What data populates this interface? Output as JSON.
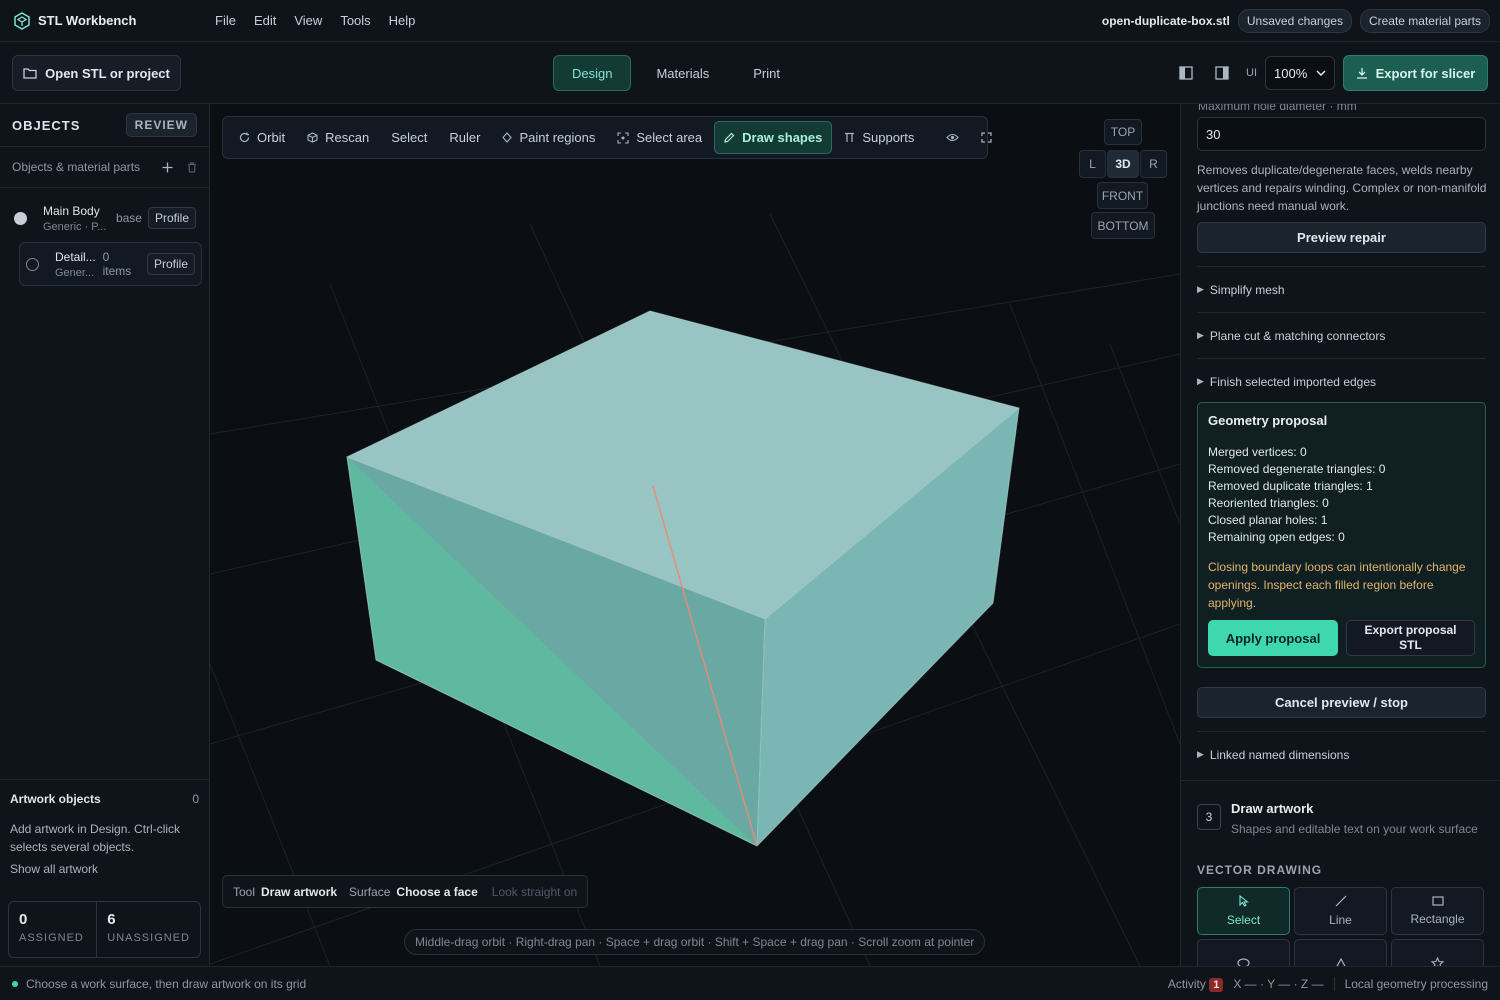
{
  "app": {
    "name": "STL Workbench",
    "menu": [
      "File",
      "Edit",
      "View",
      "Tools",
      "Help"
    ],
    "file_name": "open-duplicate-box.stl",
    "unsaved": "Unsaved changes",
    "create_parts": "Create material parts"
  },
  "toolbar": {
    "open": "Open STL or project",
    "modes": [
      "Design",
      "Materials",
      "Print"
    ],
    "active_mode": "Design",
    "ui_label": "UI",
    "zoom": "100%",
    "export": "Export for slicer"
  },
  "sidebar": {
    "title": "OBJECTS",
    "review": "REVIEW",
    "subtitle": "Objects & material parts",
    "objects": [
      {
        "name": "Main Body",
        "meta": "Generic · P...",
        "tag": "base",
        "profile": "Profile"
      },
      {
        "name": "Detail...",
        "meta": "Gener...",
        "tag": "0 items",
        "profile": "Profile"
      }
    ],
    "artwork": {
      "title": "Artwork objects",
      "count": "0",
      "desc": "Add artwork in Design. Ctrl-click selects several objects.",
      "link": "Show all artwork",
      "assigned": "0",
      "assigned_label": "ASSIGNED",
      "unassigned": "6",
      "unassigned_label": "UNASSIGNED"
    }
  },
  "viewport": {
    "tools": [
      "Orbit",
      "Rescan",
      "Select",
      "Ruler",
      "Paint regions",
      "Select area",
      "Draw shapes",
      "Supports"
    ],
    "active_tool": "Draw shapes",
    "views": {
      "top": "TOP",
      "left": "L",
      "three_d": "3D",
      "right": "R",
      "front": "FRONT",
      "bottom": "BOTTOM"
    },
    "status": {
      "tool_label": "Tool",
      "tool": "Draw artwork",
      "surface_label": "Surface",
      "surface": "Choose a face",
      "hint": "Look straight on"
    },
    "hints": "Middle-drag orbit · Right-drag pan · Space + drag orbit · Shift + Space + drag pan · Scroll zoom at pointer",
    "colors": {
      "box_top": "#98c4c3",
      "box_right": "#7ab7b4",
      "box_front": "#6aa8a3",
      "box_left": "#5fb8a0",
      "edge": "#e78b7a"
    }
  },
  "right_panel": {
    "hole_label": "Maximum hole diameter · mm",
    "hole_value": "30",
    "repair_desc": "Removes duplicate/degenerate faces, welds nearby vertices and repairs winding. Complex or non-manifold junctions need manual work.",
    "preview": "Preview repair",
    "sections": [
      "Simplify mesh",
      "Plane cut & matching connectors",
      "Finish selected imported edges"
    ],
    "proposal": {
      "title": "Geometry proposal",
      "lines": [
        "Merged vertices: 0",
        "Removed degenerate triangles: 0",
        "Removed duplicate triangles: 1",
        "Reoriented triangles: 0",
        "Closed planar holes: 1",
        "Remaining open edges: 0"
      ],
      "warning": "Closing boundary loops can intentionally change openings. Inspect each filled region before applying.",
      "apply": "Apply proposal",
      "export": "Export proposal STL"
    },
    "cancel": "Cancel preview / stop",
    "linked": "Linked named dimensions",
    "draw": {
      "step": "3",
      "title": "Draw artwork",
      "subtitle": "Shapes and editable text on your work surface",
      "vector_label": "VECTOR DRAWING",
      "tools": [
        "Select",
        "Line",
        "Rectangle"
      ]
    }
  },
  "statusbar": {
    "message": "Choose a work surface, then draw artwork on its grid",
    "activity": "Activity",
    "activity_count": "1",
    "coords": "X — · Y — · Z —",
    "processing": "Local geometry processing"
  }
}
